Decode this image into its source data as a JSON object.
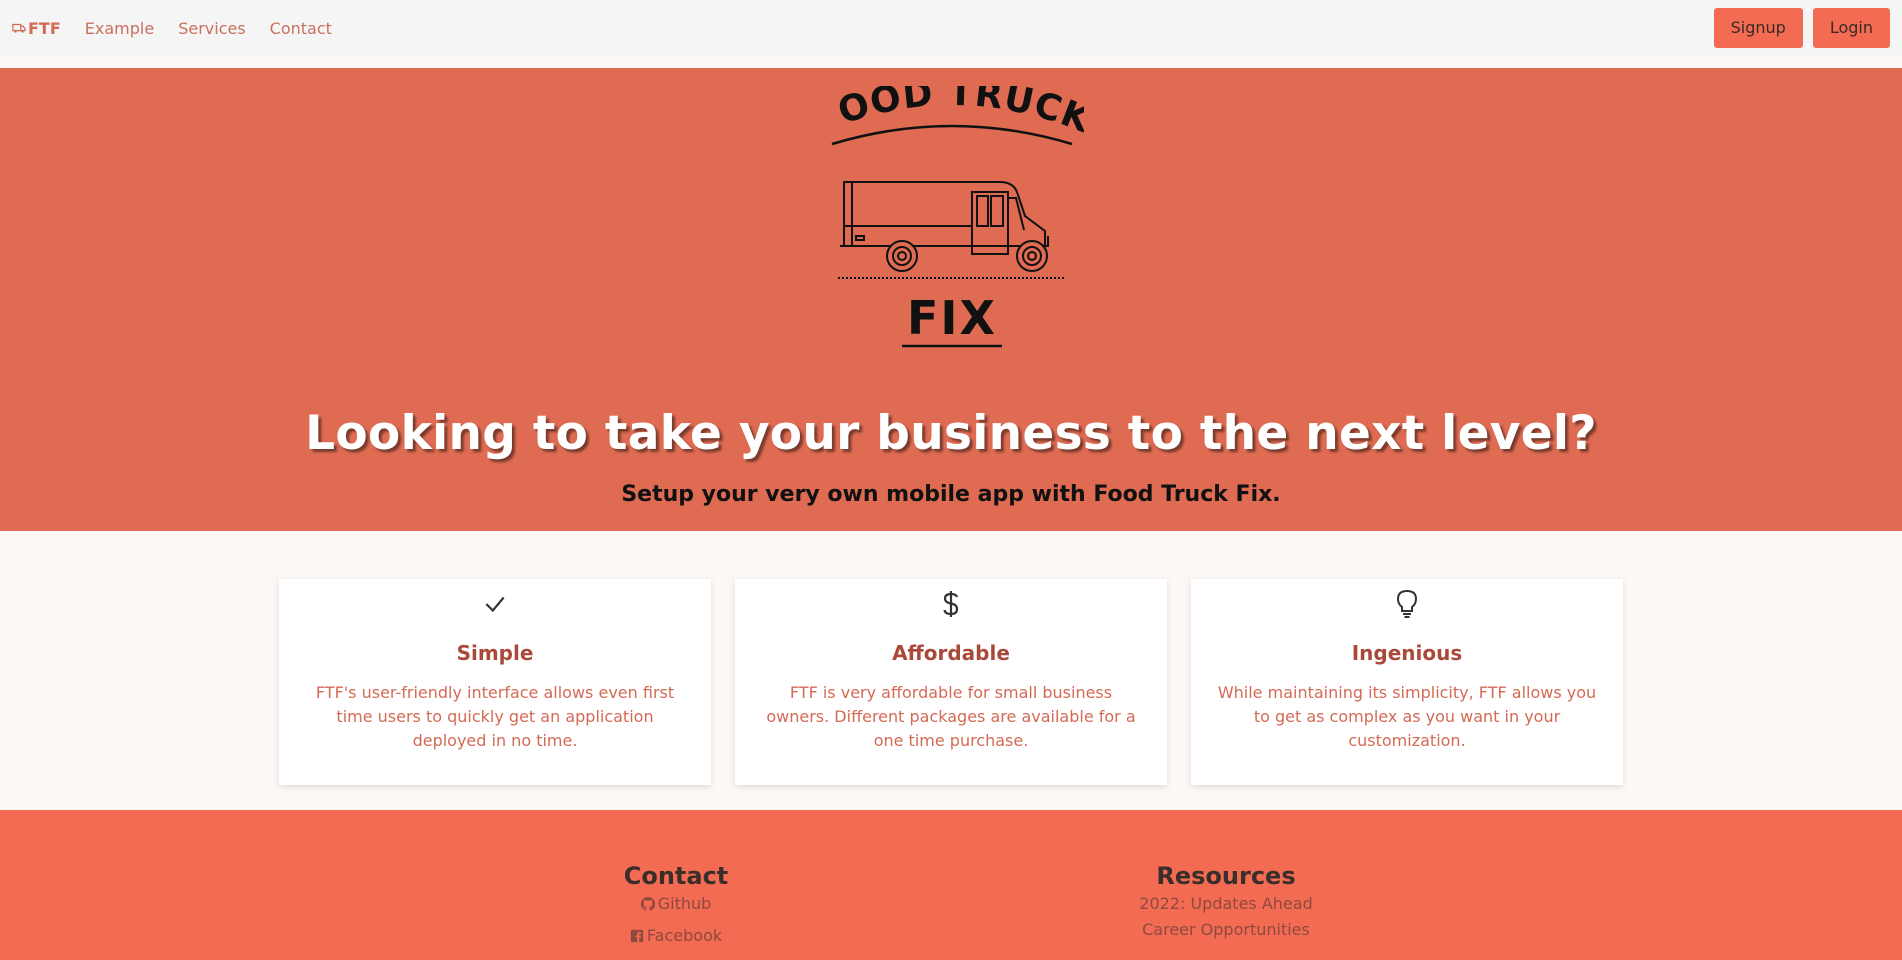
{
  "nav": {
    "brand": "FTF",
    "links": [
      "Example",
      "Services",
      "Contact"
    ],
    "signup": "Signup",
    "login": "Login"
  },
  "hero": {
    "logo_top_text": "FOOD TRUCK",
    "logo_bottom_text": "FIX",
    "title": "Looking to take your business to the next level?",
    "subtitle": "Setup your very own mobile app with Food Truck Fix."
  },
  "features": [
    {
      "icon": "check-icon",
      "title": "Simple",
      "text": "FTF's user-friendly interface allows even first time users to quickly get an application deployed in no time."
    },
    {
      "icon": "dollar-icon",
      "title": "Affordable",
      "text": "FTF is very affordable for small business owners. Different packages are available for a one time purchase."
    },
    {
      "icon": "lightbulb-icon",
      "title": "Ingenious",
      "text": "While maintaining its simplicity, FTF allows you to get as complex as you want in your customization."
    }
  ],
  "footer": {
    "contact_title": "Contact",
    "contact_links": [
      "Github",
      "Facebook"
    ],
    "resources_title": "Resources",
    "resources_links": [
      "2022: Updates Ahead",
      "Career Opportunities"
    ]
  },
  "colors": {
    "hero_bg": "#de6b52",
    "footer_bg": "#f26b52",
    "button_bg": "#f26b52",
    "accent_text": "#d46a55"
  }
}
